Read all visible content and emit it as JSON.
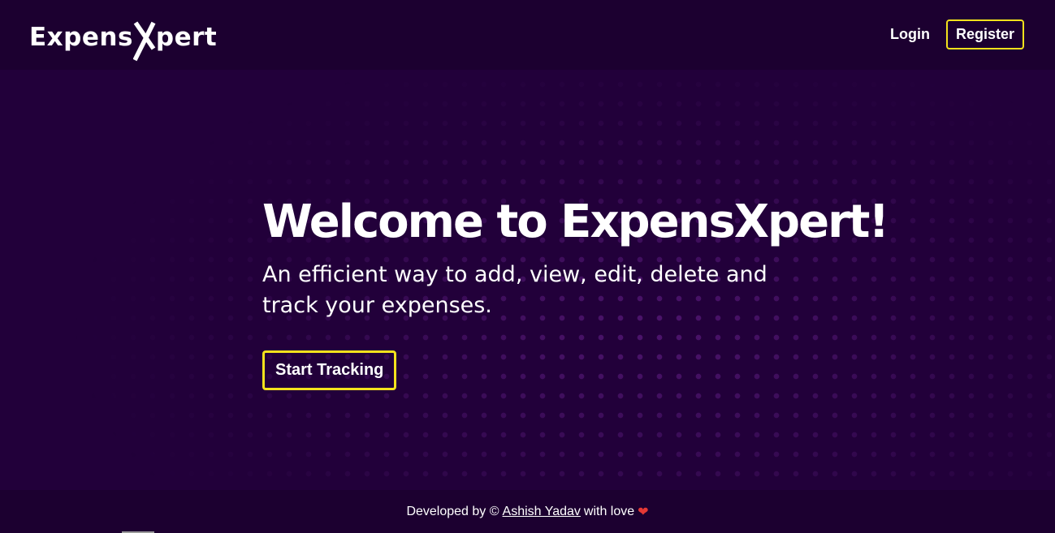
{
  "navbar": {
    "logo_prefix": "Expens",
    "logo_suffix": "pert",
    "login_label": "Login",
    "register_label": "Register"
  },
  "hero": {
    "title": "Welcome to ExpensXpert!",
    "subtitle": "An efficient way to add, view, edit, delete and track your expenses.",
    "cta_label": "Start Tracking"
  },
  "footer": {
    "prefix": "Developed by ©",
    "author": "Ashish Yadav",
    "suffix": "with love",
    "heart": "❤"
  },
  "colors": {
    "background": "#22003a",
    "navbar": "#1c0030",
    "accent_border": "#f4e21c",
    "heart": "#e53935"
  },
  "icons": {
    "logo_mark": "x-logo-icon",
    "heart": "heart-icon"
  }
}
